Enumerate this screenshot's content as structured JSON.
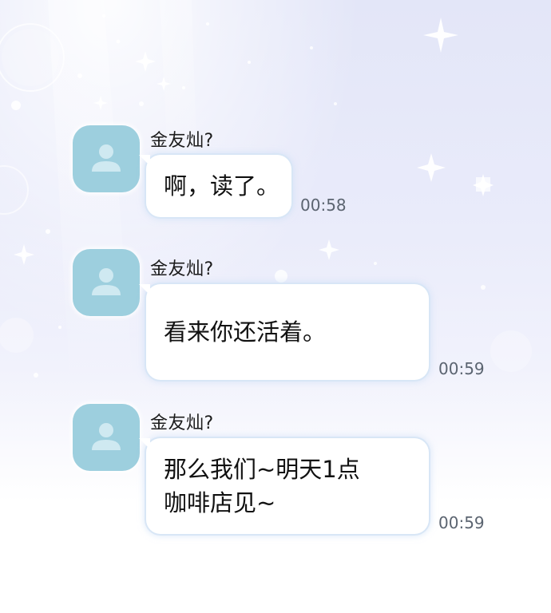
{
  "chat": {
    "messages": [
      {
        "sender": "金友灿?",
        "text": "啊，读了。",
        "time": "00:58",
        "avatar_icon": "person-silhouette-icon"
      },
      {
        "sender": "金友灿?",
        "text": "看来你还活着。",
        "time": "00:59",
        "avatar_icon": "person-silhouette-icon"
      },
      {
        "sender": "金友灿?",
        "text": "那么我们~明天1点\n咖啡店见~",
        "time": "00:59",
        "avatar_icon": "person-silhouette-icon"
      }
    ]
  },
  "colors": {
    "avatar_bg": "#9dcfde",
    "avatar_figure": "#cfe9f1",
    "bubble_bg": "#ffffff",
    "bubble_border": "#d8e6f6",
    "time_text": "#5b6470"
  }
}
